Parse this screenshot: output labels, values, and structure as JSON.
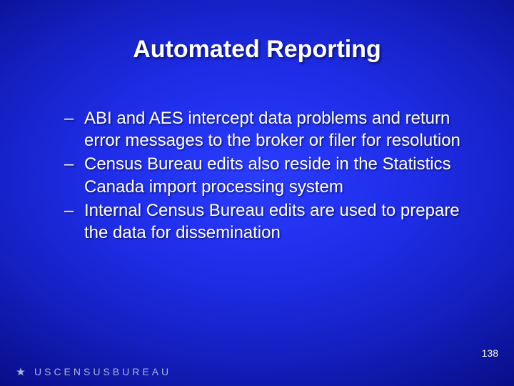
{
  "title": "Automated Reporting",
  "bullets": [
    "ABI and AES intercept data problems and return error messages to the broker or filer for resolution",
    "Census Bureau edits also reside in the Statistics Canada import processing system",
    "Internal Census Bureau edits are used to prepare the data for dissemination"
  ],
  "page_number": "138",
  "logo_text": "USCENSUSBUREAU"
}
